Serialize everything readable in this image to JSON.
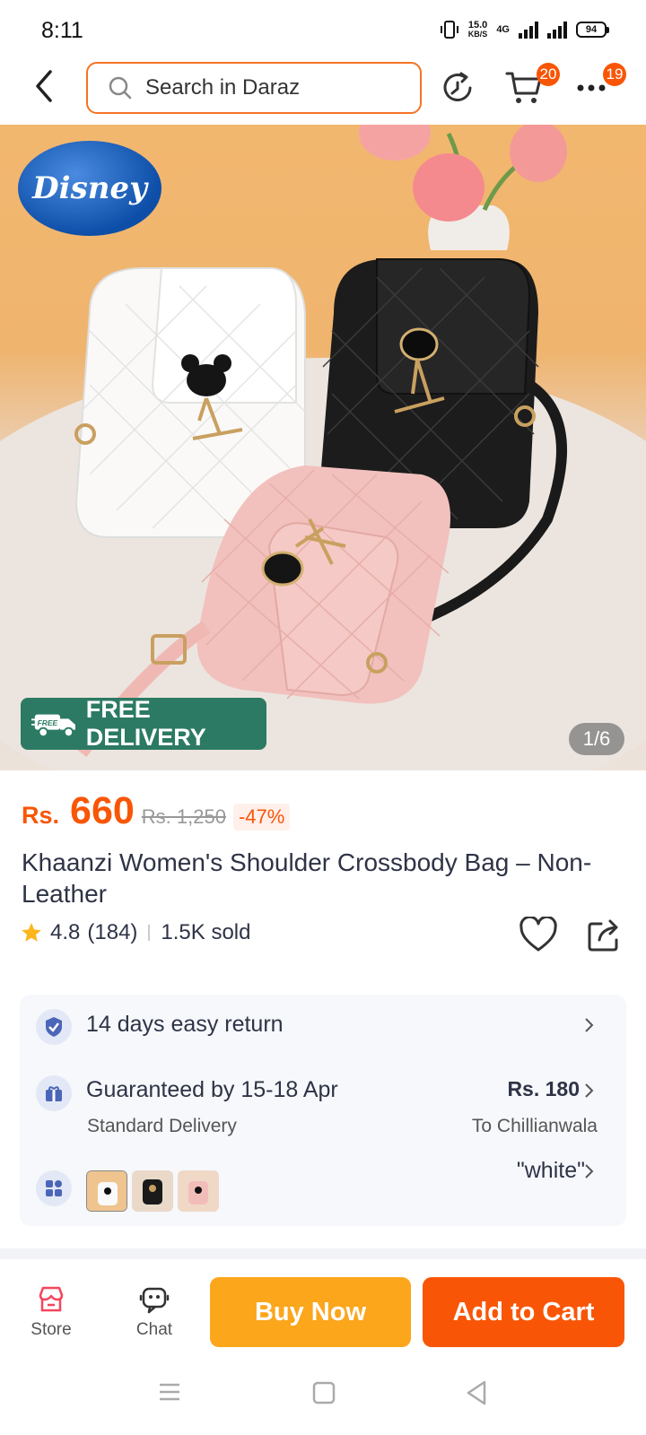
{
  "status_bar": {
    "time": "8:11",
    "speed_value": "15.0",
    "speed_unit": "KB/S",
    "network": "4G",
    "battery": "94"
  },
  "header": {
    "search_placeholder": "Search in Daraz",
    "cart_badge": "20",
    "more_badge": "19"
  },
  "hero": {
    "brand_logo_text": "Disney",
    "delivery_badge_small": "FREE",
    "delivery_badge": "FREE DELIVERY",
    "image_counter": "1/6"
  },
  "product": {
    "currency": "Rs.",
    "price": "660",
    "original_price": "Rs. 1,250",
    "discount": "-47%",
    "title": "Khaanzi Women's Shoulder Crossbody Bag – Non-Leather",
    "rating": "4.8",
    "rating_count": "(184)",
    "sold": "1.5K sold"
  },
  "info": {
    "return_text": "14 days easy return",
    "delivery_text": "Guaranteed by 15-18 Apr",
    "delivery_type": "Standard Delivery",
    "delivery_fee": "Rs. 180",
    "delivery_destination": "To Chillianwala",
    "selected_variant": "\"white\"",
    "variants": [
      "white",
      "black",
      "pink"
    ]
  },
  "bottom_bar": {
    "store_label": "Store",
    "chat_label": "Chat",
    "buy_now": "Buy Now",
    "add_to_cart": "Add to Cart"
  },
  "colors": {
    "accent": "#f85606",
    "buy_now_bg": "#fca61c",
    "add_to_cart_bg": "#f85606",
    "search_border": "#f57224",
    "delivery_badge_bg": "#2c7a64"
  }
}
